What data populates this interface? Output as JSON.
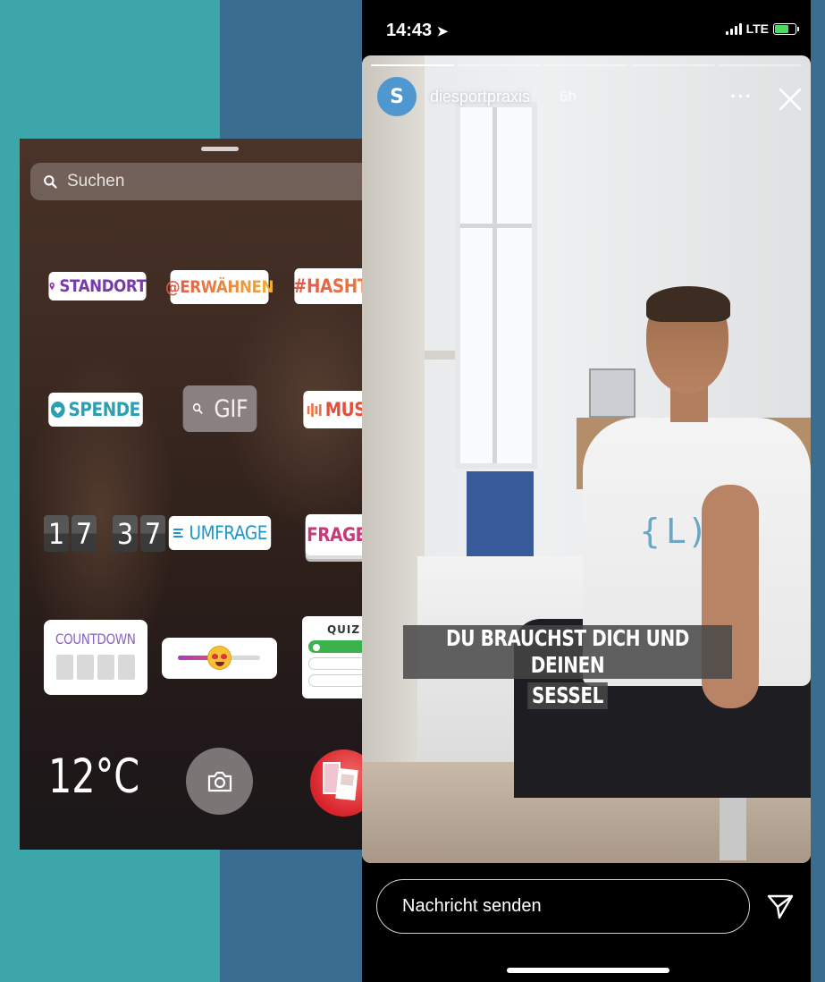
{
  "tray": {
    "search_placeholder": "Suchen",
    "stickers": {
      "standort": "STANDORT",
      "erwaehnen": "@ERWÄHNEN",
      "hashtag": "#HASHTAG",
      "spende": "SPENDE",
      "gif": "GIF",
      "musik": "MUSIK",
      "clock_digits": [
        "1",
        "7",
        "3",
        "7"
      ],
      "umfrage": "UMFRAGE",
      "fragen": "FRAGEN",
      "countdown": "COUNTDOWN",
      "slider_fill_fraction": 0.45,
      "quiz": "QUIZ",
      "temperature": "12°C"
    }
  },
  "status_bar": {
    "time": "14:43",
    "network": "LTE"
  },
  "story": {
    "progress": {
      "segments": 5,
      "completed": 1
    },
    "username": "diesportpraxis",
    "time_ago": "6h",
    "more_label": "···",
    "caption_line1": "DU BRAUCHST DICH UND DEINEN",
    "caption_line2": "SESSEL",
    "shirt_logo": "{L)(=",
    "avatar_text": "S"
  },
  "reply": {
    "placeholder": "Nachricht senden"
  },
  "colors": {
    "left_bg": "#3ca6aa",
    "mid_bg": "#3a6d90",
    "caption_bg": "#464646"
  }
}
